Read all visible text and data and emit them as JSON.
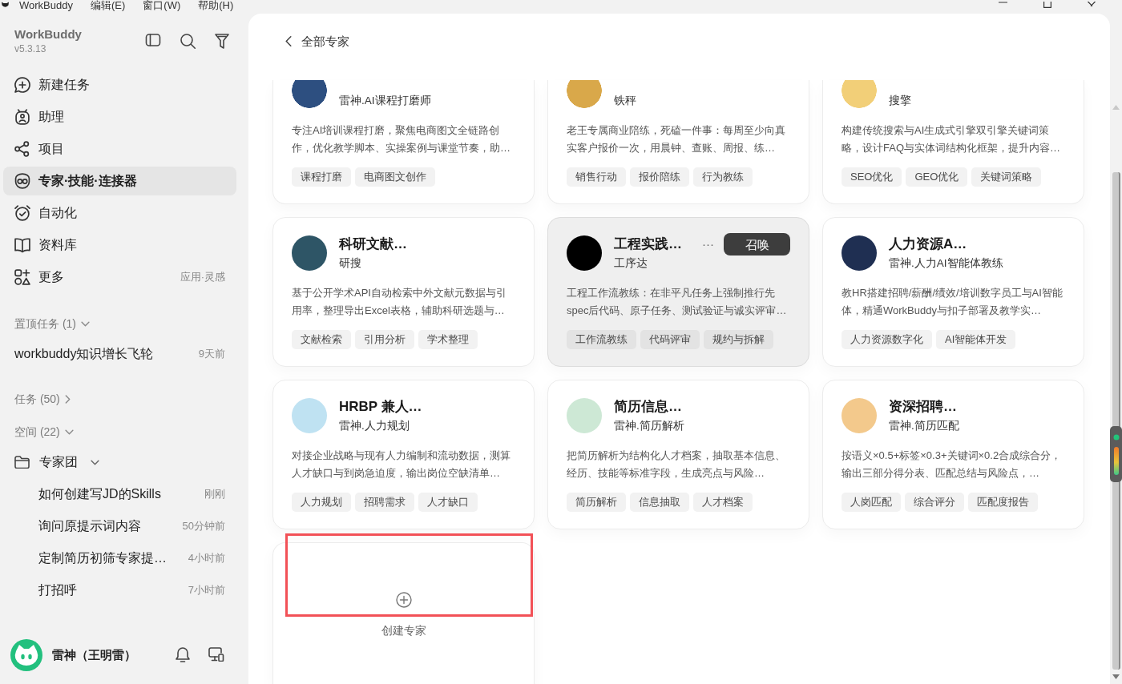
{
  "menubar": [
    "WorkBuddy",
    "编辑(E)",
    "窗口(W)",
    "帮助(H)"
  ],
  "sidebar": {
    "app_name": "WorkBuddy",
    "version": "v5.3.13",
    "nav": [
      {
        "label": "新建任务",
        "selected": false
      },
      {
        "label": "助理",
        "selected": false
      },
      {
        "label": "项目",
        "selected": false
      },
      {
        "label": "专家·技能·连接器",
        "selected": true
      },
      {
        "label": "自动化",
        "selected": false
      },
      {
        "label": "资料库",
        "selected": false
      },
      {
        "label": "更多",
        "selected": false,
        "note": "应用·灵感"
      }
    ],
    "pinned": {
      "label": "置顶任务 (1)",
      "expanded": true,
      "items": [
        {
          "title": "workbuddy知识增长飞轮",
          "time": "9天前"
        }
      ]
    },
    "tasks": {
      "label": "任务 (50)",
      "expanded": false
    },
    "spaces": {
      "label": "空间 (22)",
      "expanded": true,
      "children": [
        {
          "name": "专家团",
          "expanded": true,
          "children": [
            {
              "title": "如何创建写JD的Skills",
              "time": "刚刚"
            },
            {
              "title": "询问原提示词内容",
              "time": "50分钟前"
            },
            {
              "title": "定制简历初筛专家提…",
              "time": "4小时前"
            },
            {
              "title": "打招呼",
              "time": "7小时前"
            }
          ]
        }
      ]
    },
    "user": {
      "name": "雷神（王明雷）"
    }
  },
  "page": {
    "title": "全部专家"
  },
  "experts": [
    {
      "subtitle": "雷神.AI课程打磨师",
      "description": "专注AI培训课程打磨，聚焦电商图文全链路创作，优化教学脚本、实操案例与课堂节奏，助…",
      "tags": [
        "课程打磨",
        "电商图文创作"
      ],
      "color": "#2d4f80",
      "hovered": false
    },
    {
      "subtitle": "铁秤",
      "description": "老王专属商业陪练，死磕一件事：每周至少向真实客户报价一次，用晨钟、查账、周报、练…",
      "tags": [
        "销售行动",
        "报价陪练",
        "行为教练"
      ],
      "color": "#d9a84a",
      "hovered": false
    },
    {
      "subtitle": "搜擎",
      "description": "构建传统搜索与AI生成式引擎双引擎关键词策略，设计FAQ与实体词结构化框架，提升内容…",
      "tags": [
        "SEO优化",
        "GEO优化",
        "关键词策略"
      ],
      "color": "#f2cf78",
      "hovered": false
    },
    {
      "title": "科研文献…",
      "subtitle": "研搜",
      "description": "基于公开学术API自动检索中外文献元数据与引用率，整理导出Excel表格，辅助科研选题与…",
      "tags": [
        "文献检索",
        "引用分析",
        "学术整理"
      ],
      "color": "#2e5566",
      "hovered": false
    },
    {
      "title": "工程实践…",
      "subtitle": "工序达",
      "description": "工程工作流教练：在非平凡任务上强制推行先spec后代码、原子任务、测试验证与诚实评审…",
      "tags": [
        "工作流教练",
        "代码评审",
        "规约与拆解"
      ],
      "color": "#000000",
      "hovered": true,
      "more": "···",
      "action": "召唤"
    },
    {
      "title": "人力资源A…",
      "subtitle": "雷神.人力AI智能体教练",
      "description": "教HR搭建招聘/薪酬/绩效/培训数字员工与AI智能体，精通WorkBuddy与扣子部署及教学实…",
      "tags": [
        "人力资源数字化",
        "AI智能体开发"
      ],
      "color": "#1f2f52",
      "hovered": false
    },
    {
      "title": "HRBP 兼人…",
      "subtitle": "雷神.人力规划",
      "description": "对接企业战略与现有人力编制和流动数据，测算人才缺口与到岗急迫度，输出岗位空缺清单…",
      "tags": [
        "人力规划",
        "招聘需求",
        "人才缺口"
      ],
      "color": "#bfe2f2",
      "hovered": false
    },
    {
      "title": "简历信息…",
      "subtitle": "雷神.简历解析",
      "description": "把简历解析为结构化人才档案，抽取基本信息、经历、技能等标准字段，生成亮点与风险…",
      "tags": [
        "简历解析",
        "信息抽取",
        "人才档案"
      ],
      "color": "#cde8d5",
      "hovered": false
    },
    {
      "title": "资深招聘…",
      "subtitle": "雷神.简历匹配",
      "description": "按语义×0.5+标签×0.3+关键词×0.2合成综合分，输出三部分得分表、匹配总结与风险点，…",
      "tags": [
        "人岗匹配",
        "综合评分",
        "匹配度报告"
      ],
      "color": "#f3c98c",
      "hovered": false
    }
  ],
  "create_card": {
    "label": "创建专家",
    "highlighted": true
  }
}
